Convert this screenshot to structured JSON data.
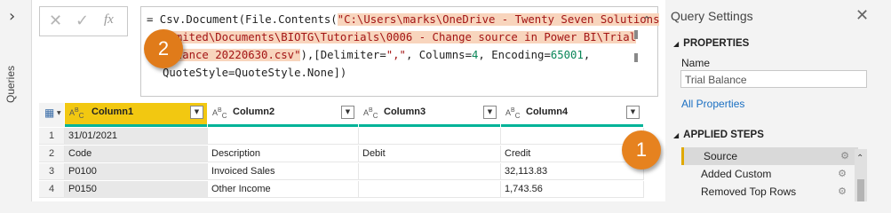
{
  "left_panel": {
    "toggle_icon": "chevron-right-icon",
    "label": "Queries"
  },
  "formula_bar": {
    "cancel_icon": "close-icon",
    "commit_icon": "checkmark-icon",
    "fx_label": "fx",
    "lines": {
      "l1_a": "= Csv.Document(File.Contents(",
      "l1_b": "\"C:\\Users\\marks\\OneDrive - Twenty Seven Solutions",
      "l2": "Limited\\Documents\\BIOTG\\Tutorials\\0006 - Change source in Power BI\\Trial",
      "l3_a": "Balance 20220630.csv\"",
      "l3_b": "),[Delimiter=",
      "l3_c": "\",\"",
      "l3_d": ", Columns=",
      "l3_e": "4",
      "l3_f": ", Encoding=",
      "l3_g": "65001",
      "l3_h": ",",
      "l4": "QuoteStyle=QuoteStyle.None])"
    },
    "highlight_color": "#f8d5bd"
  },
  "callouts": {
    "one": "1",
    "two": "2",
    "color": "#e07b1a"
  },
  "table": {
    "columns": [
      {
        "type": "ABC",
        "name": "Column1"
      },
      {
        "type": "ABC",
        "name": "Column2"
      },
      {
        "type": "ABC",
        "name": "Column3"
      },
      {
        "type": "ABC",
        "name": "Column4"
      }
    ],
    "rows": [
      {
        "n": "1",
        "c": [
          "31/01/2021",
          "",
          "",
          ""
        ]
      },
      {
        "n": "2",
        "c": [
          "Code",
          "Description",
          "Debit",
          "Credit"
        ]
      },
      {
        "n": "3",
        "c": [
          "P0100",
          "Invoiced Sales",
          "",
          "32,113.83"
        ]
      },
      {
        "n": "4",
        "c": [
          "P0150",
          "Other Income",
          "",
          "1,743.56"
        ]
      }
    ],
    "quality_bar_color": "#00b398",
    "selected_header_color": "#f2c811"
  },
  "query_settings": {
    "title": "Query Settings",
    "close_icon": "close-icon",
    "properties_heading": "PROPERTIES",
    "name_label": "Name",
    "name_value": "Trial Balance",
    "all_properties_link": "All Properties",
    "applied_steps_heading": "APPLIED STEPS",
    "steps": [
      {
        "label": "Source",
        "selected": true
      },
      {
        "label": "Added Custom",
        "selected": false
      },
      {
        "label": "Removed Top Rows",
        "selected": false
      }
    ]
  }
}
